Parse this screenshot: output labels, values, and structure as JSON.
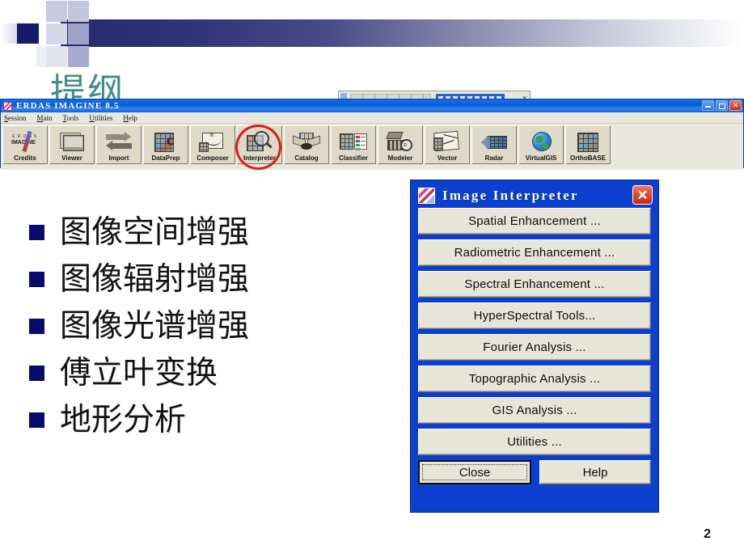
{
  "slide": {
    "title": "提纲",
    "title_color": "#3f8d85",
    "page_number": "2",
    "bullet_color": "#070a6e",
    "bullets": [
      {
        "text": "图像空间增强"
      },
      {
        "text": "图像辐射增强"
      },
      {
        "text": "图像光谱增强"
      },
      {
        "text": "傅立叶变换"
      },
      {
        "text": "地形分析"
      }
    ]
  },
  "erdas_window": {
    "title": "ERDAS IMAGINE 8.5",
    "accent_color": "#0b5cd6",
    "window_controls": {
      "minimize": "minimize-icon",
      "maximize": "maximize-icon",
      "close": "close-icon"
    },
    "menus": [
      {
        "label": "Session",
        "mnemonic": "S",
        "rest": "ession"
      },
      {
        "label": "Main",
        "mnemonic": "M",
        "rest": "ain"
      },
      {
        "label": "Tools",
        "mnemonic": "T",
        "rest": "ools"
      },
      {
        "label": "Utilities",
        "mnemonic": "U",
        "rest": "tilities"
      },
      {
        "label": "Help",
        "mnemonic": "H",
        "rest": "elp"
      }
    ],
    "toolbar": [
      {
        "label": "Credits",
        "icon": "erdas-imagine-credits-icon",
        "highlighted": false
      },
      {
        "label": "Viewer",
        "icon": "viewer-monitor-icon",
        "highlighted": false
      },
      {
        "label": "Import",
        "icon": "import-arrows-icon",
        "highlighted": false
      },
      {
        "label": "DataPrep",
        "icon": "dataprep-grid-icon",
        "highlighted": false
      },
      {
        "label": "Composer",
        "icon": "composer-map-icon",
        "highlighted": false
      },
      {
        "label": "Interpreter",
        "icon": "interpreter-magnifier-icon",
        "highlighted": true
      },
      {
        "label": "Catalog",
        "icon": "catalog-icon",
        "highlighted": false
      },
      {
        "label": "Classifier",
        "icon": "classifier-legend-icon",
        "highlighted": false
      },
      {
        "label": "Modeler",
        "icon": "modeler-icon",
        "highlighted": false
      },
      {
        "label": "Vector",
        "icon": "vector-sheet-icon",
        "highlighted": false
      },
      {
        "label": "Radar",
        "icon": "radar-fan-icon",
        "highlighted": false
      },
      {
        "label": "VirtualGIS",
        "icon": "virtualgis-globe-icon",
        "highlighted": false
      },
      {
        "label": "OrthoBASE",
        "icon": "orthobase-grid-icon",
        "highlighted": false
      }
    ],
    "highlight_color": "#e01b12"
  },
  "dialog": {
    "title": "Image Interpreter",
    "close_icon": "dialog-close-icon",
    "titlebar_color": "#0a3fd0",
    "buttons": [
      {
        "label": "Spatial Enhancement ..."
      },
      {
        "label": "Radiometric Enhancement ..."
      },
      {
        "label": "Spectral Enhancement ..."
      },
      {
        "label": "HyperSpectral Tools..."
      },
      {
        "label": "Fourier Analysis ..."
      },
      {
        "label": "Topographic Analysis ..."
      },
      {
        "label": "GIS Analysis ..."
      },
      {
        "label": "Utilities ..."
      }
    ],
    "footer": {
      "close_label": "Close",
      "help_label": "Help"
    }
  }
}
